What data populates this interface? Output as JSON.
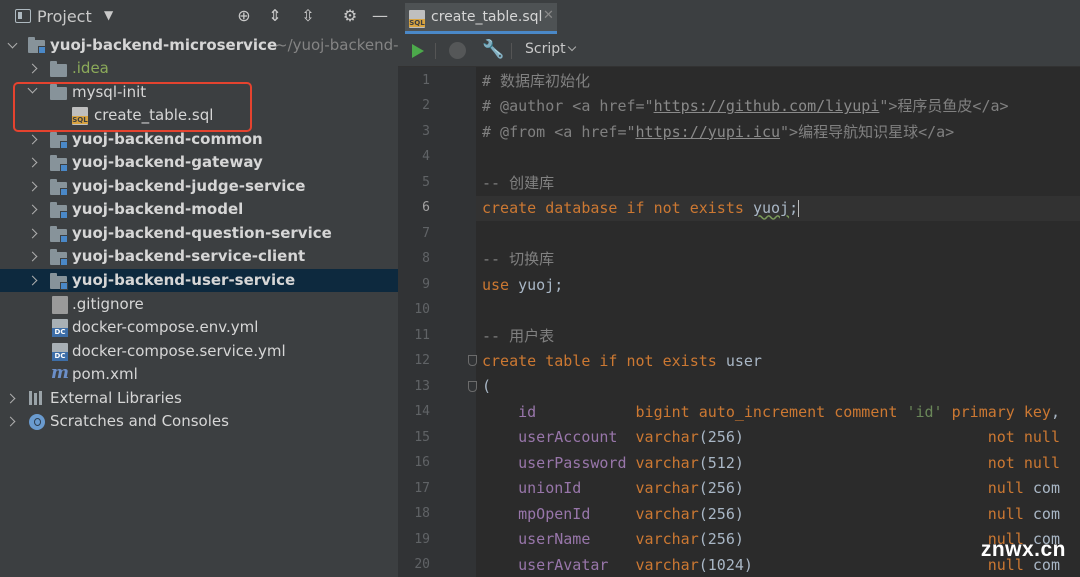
{
  "project_panel": {
    "title": "Project",
    "tree": [
      {
        "label": "yuoj-backend-microservice",
        "suffix": "~/yuoj-backend-",
        "expanded": true,
        "bold": true
      },
      {
        "label": ".idea",
        "expanded": false
      },
      {
        "label": "mysql-init",
        "expanded": true
      },
      {
        "label": "create_table.sql"
      },
      {
        "label": "yuoj-backend-common",
        "expanded": false,
        "bold": true
      },
      {
        "label": "yuoj-backend-gateway",
        "expanded": false,
        "bold": true
      },
      {
        "label": "yuoj-backend-judge-service",
        "expanded": false,
        "bold": true
      },
      {
        "label": "yuoj-backend-model",
        "expanded": false,
        "bold": true
      },
      {
        "label": "yuoj-backend-question-service",
        "expanded": false,
        "bold": true
      },
      {
        "label": "yuoj-backend-service-client",
        "expanded": false,
        "bold": true
      },
      {
        "label": "yuoj-backend-user-service",
        "expanded": false,
        "bold": true,
        "selected": true
      },
      {
        "label": ".gitignore"
      },
      {
        "label": "docker-compose.env.yml"
      },
      {
        "label": "docker-compose.service.yml"
      },
      {
        "label": "pom.xml"
      },
      {
        "label": "External Libraries",
        "expanded": false
      },
      {
        "label": "Scratches and Consoles",
        "expanded": false
      }
    ]
  },
  "editor": {
    "tab_label": "create_table.sql",
    "toolbar": {
      "script_label": "Script"
    },
    "current_line": 6,
    "lines": [
      {
        "n": "1",
        "text": "# 数据库初始化"
      },
      {
        "n": "2",
        "text": "# @author <a href=\"https://github.com/liyupi\">程序员鱼皮</a>"
      },
      {
        "n": "3",
        "text": "# @from <a href=\"https://yupi.icu\">编程导航知识星球</a>"
      },
      {
        "n": "4",
        "text": ""
      },
      {
        "n": "5",
        "text": "-- 创建库"
      },
      {
        "n": "6",
        "text": "create database if not exists yuoj;"
      },
      {
        "n": "7",
        "text": ""
      },
      {
        "n": "8",
        "text": "-- 切换库"
      },
      {
        "n": "9",
        "text": "use yuoj;"
      },
      {
        "n": "10",
        "text": ""
      },
      {
        "n": "11",
        "text": "-- 用户表"
      },
      {
        "n": "12",
        "text": "create table if not exists user"
      },
      {
        "n": "13",
        "text": "("
      },
      {
        "n": "14",
        "text": "    id           bigint auto_increment comment 'id' primary key,"
      },
      {
        "n": "15",
        "text": "    userAccount  varchar(256)                           not null"
      },
      {
        "n": "16",
        "text": "    userPassword varchar(512)                           not null"
      },
      {
        "n": "17",
        "text": "    unionId      varchar(256)                           null com"
      },
      {
        "n": "18",
        "text": "    mpOpenId     varchar(256)                           null com"
      },
      {
        "n": "19",
        "text": "    userName     varchar(256)                           null com"
      },
      {
        "n": "20",
        "text": "    userAvatar   varchar(1024)                          null com"
      }
    ]
  },
  "watermark": "znwx.cn",
  "colors": {
    "panel_bg": "#3c3f41",
    "editor_bg": "#2b2b2b",
    "selection": "#0d293e",
    "keyword": "#cc7832",
    "string": "#6a8759",
    "comment": "#808080",
    "highlight_box": "#e5432f",
    "accent": "#4a88c7"
  }
}
